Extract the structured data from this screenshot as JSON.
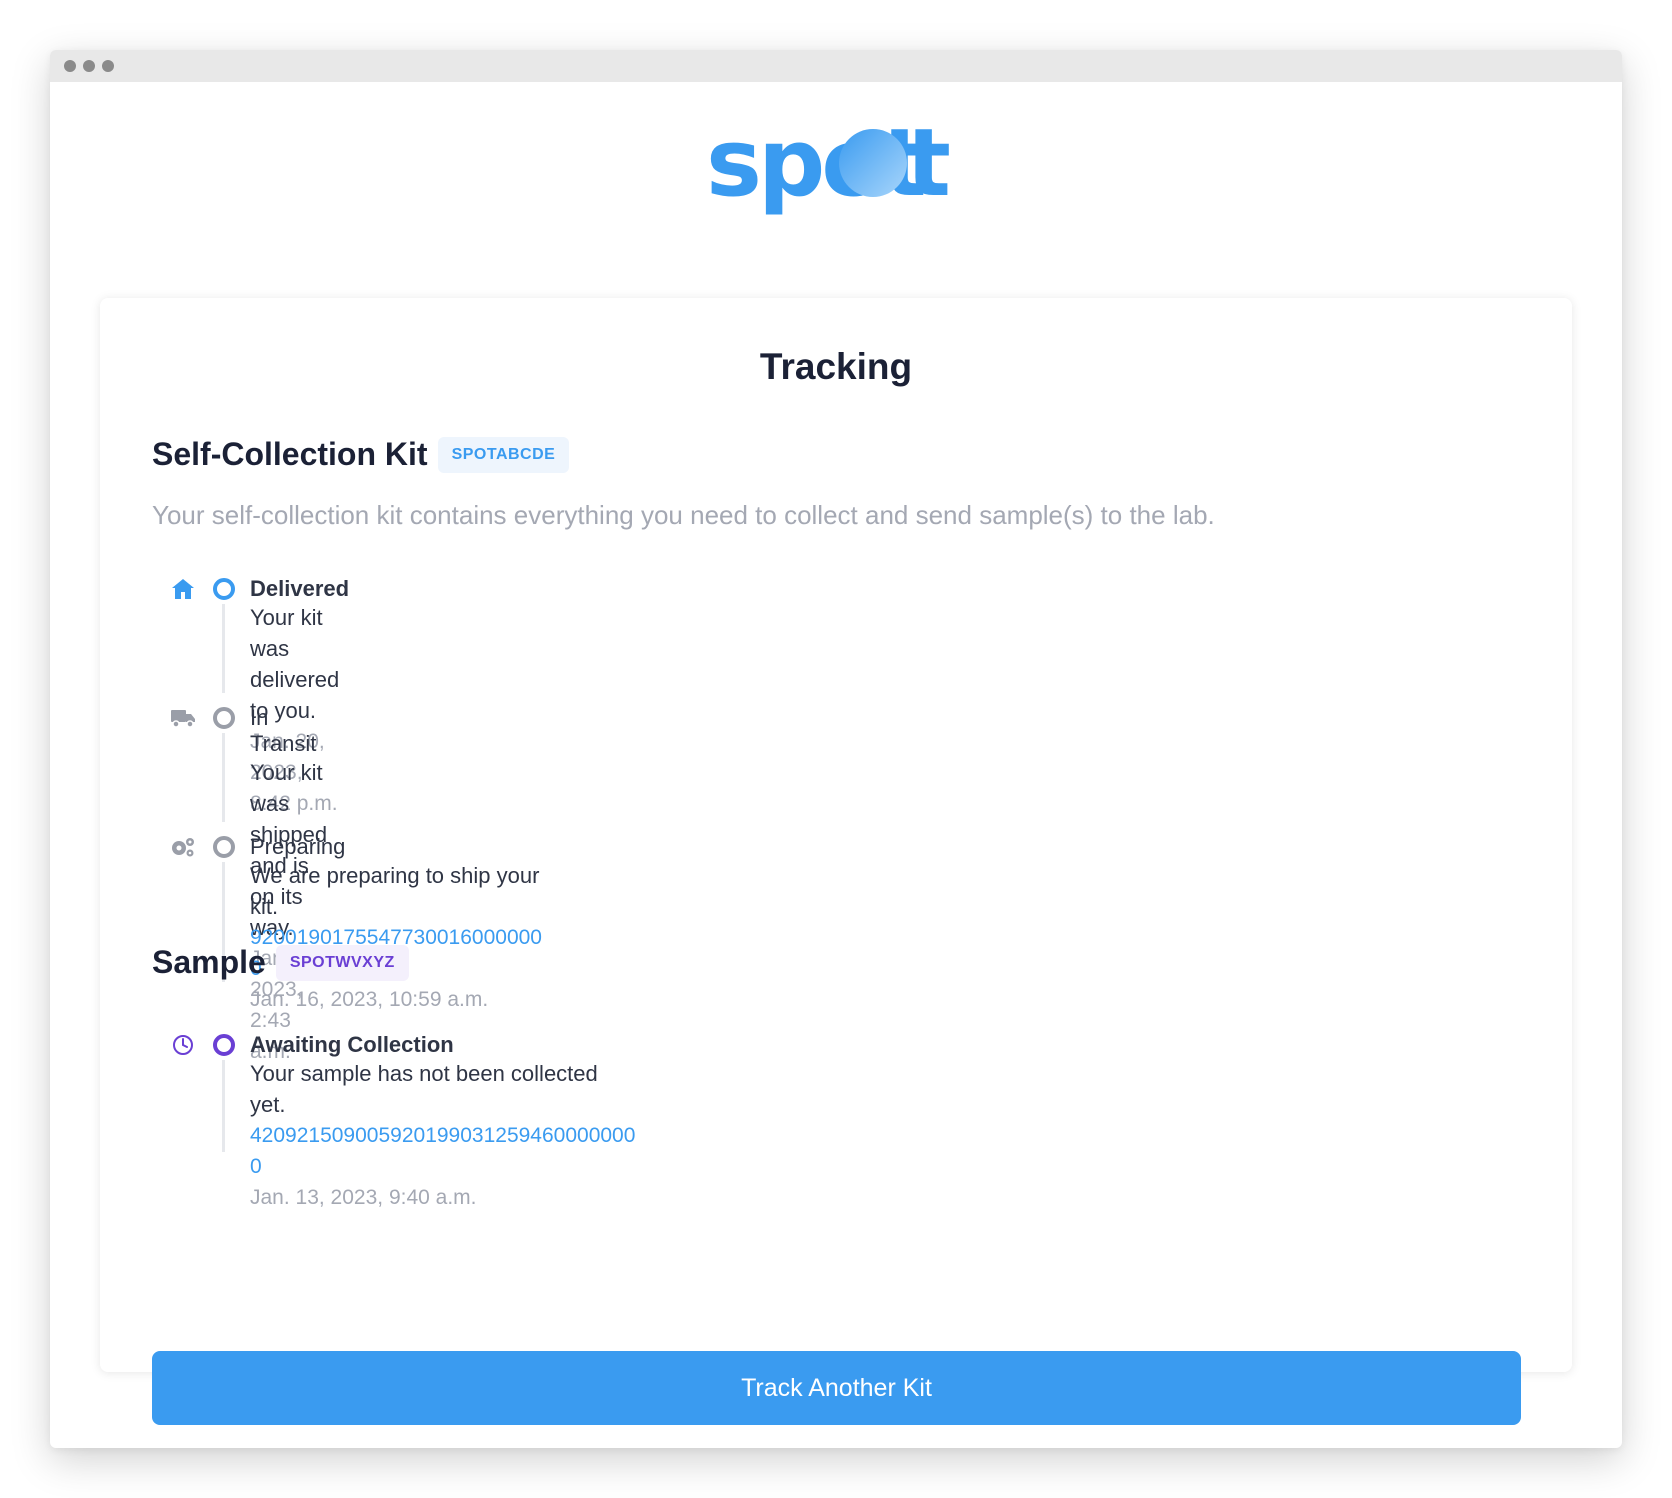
{
  "app": {
    "logo_text": "spot",
    "brand_color": "#3a9bf0"
  },
  "card": {
    "title": "Tracking"
  },
  "kit": {
    "title": "Self-Collection Kit",
    "badge": "SPOTABCDE",
    "description": "Your self-collection kit contains everything you need to collect and send sample(s) to the lab.",
    "steps": [
      {
        "icon": "home-icon",
        "status": "Delivered",
        "description": "Your kit was delivered to you.",
        "time": "Jan. 20, 2023, 8:42 p.m."
      },
      {
        "icon": "truck-icon",
        "status": "In Transit",
        "description": "Your kit was shipped and is on its way.",
        "time": "Jan. 18, 2023, 2:43 a.m."
      },
      {
        "icon": "gears-icon",
        "status": "Preparing",
        "description": "We are preparing to ship your kit.",
        "tracking": "9200190175547730016000000​0",
        "time": "Jan. 16, 2023, 10:59 a.m."
      }
    ]
  },
  "sample": {
    "title": "Sample",
    "badge": "SPOTWVXYZ",
    "steps": [
      {
        "icon": "clock-icon",
        "status": "Awaiting Collection",
        "description": "Your sample has not been collected yet.",
        "tracking": "420921509005920199031259460000000​0",
        "time": "Jan. 13, 2023, 9:40 a.m."
      }
    ]
  },
  "actions": {
    "track_another": "Track Another Kit"
  }
}
